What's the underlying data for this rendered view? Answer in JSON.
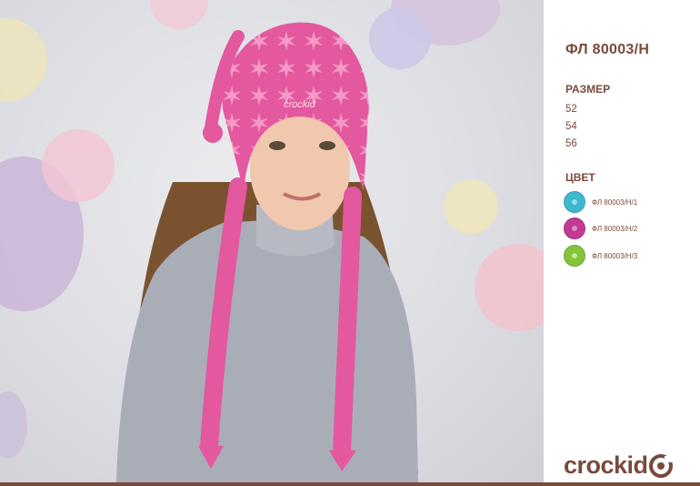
{
  "product": {
    "code": "ФЛ 80003/Н"
  },
  "size_section": {
    "title": "РАЗМЕР",
    "sizes": [
      "52",
      "54",
      "56"
    ]
  },
  "color_section": {
    "title": "ЦВЕТ",
    "variants": [
      {
        "label": "ФЛ 80003/Н/1",
        "swatch_color": "#3fb8cf"
      },
      {
        "label": "ФЛ 80003/Н/2",
        "swatch_color": "#c23a96"
      },
      {
        "label": "ФЛ 80003/Н/3",
        "swatch_color": "#86c33d"
      }
    ]
  },
  "brand": {
    "logo_text": "crockid",
    "logo_color": "#7a4a3c"
  },
  "photo": {
    "hat_color": "#e3589f",
    "hat_star_color": "#f59ac6",
    "sweater_color": "#a9adb8",
    "hair_color": "#7a5230",
    "skin_color": "#f1c7ae",
    "hat_logo": "crockid"
  }
}
